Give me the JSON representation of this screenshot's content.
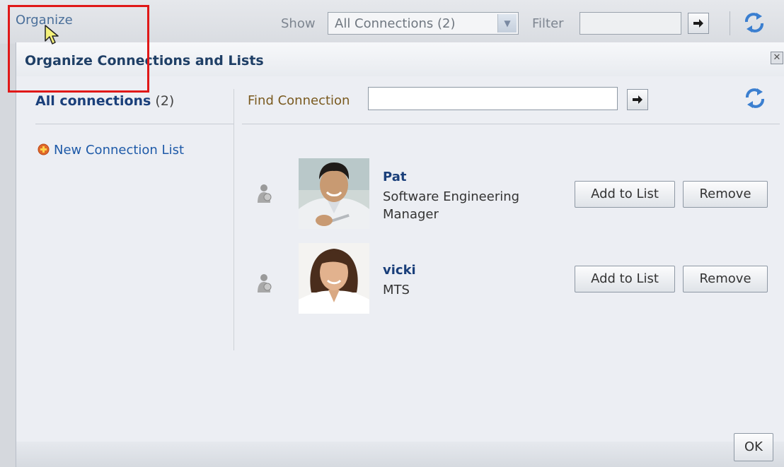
{
  "toolbar": {
    "organize_label": "Organize",
    "show_label": "Show",
    "show_select_value": "All Connections (2)",
    "filter_label": "Filter",
    "filter_value": ""
  },
  "dialog": {
    "title": "Organize Connections and Lists",
    "close_icon": "close-icon",
    "left_panel": {
      "all_connections_label": "All connections",
      "all_connections_count": "(2)",
      "new_list_label": "New Connection List"
    },
    "find": {
      "label": "Find Connection",
      "value": ""
    },
    "connections": [
      {
        "name": "Pat",
        "title": "Software Engineering Manager",
        "add_label": "Add to List",
        "remove_label": "Remove"
      },
      {
        "name": "vicki",
        "title": "MTS",
        "add_label": "Add to List",
        "remove_label": "Remove"
      }
    ],
    "ok_label": "OK"
  },
  "colors": {
    "highlight": "#e01818",
    "link": "#1e5aa8",
    "title": "#1f3f66"
  }
}
